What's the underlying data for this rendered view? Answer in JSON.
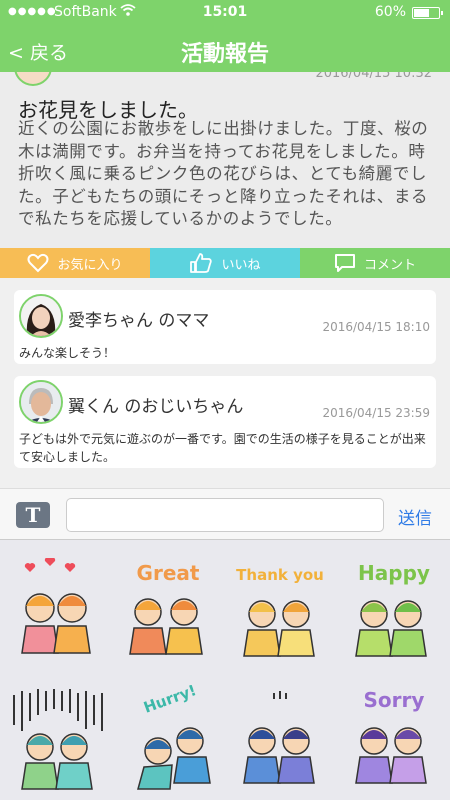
{
  "status": {
    "carrier": "SoftBank",
    "time": "15:01",
    "battery": "60%"
  },
  "nav": {
    "back_label": "< 戻る",
    "title": "活動報告"
  },
  "post": {
    "date": "2016/04/15 10:32",
    "heading": "お花見をしました。",
    "body": "近くの公園にお散歩をしに出掛けました。丁度、桜の木は満開です。お弁当を持ってお花見をしました。時折吹く風に乗るピンク色の花びらは、とても綺麗でした。子どもたちの頭にそっと降り立ったそれは、まるで私たちを応援しているかのようでした。"
  },
  "actions": {
    "favorite": "お気に入り",
    "like": "いいね",
    "comment": "コメント"
  },
  "comments": [
    {
      "name": "愛李ちゃん のママ",
      "date": "2016/04/15 18:10",
      "text": "みんな楽しそう！"
    },
    {
      "name": "翼くん のおじいちゃん",
      "date": "2016/04/15 23:59",
      "text": "子どもは外で元気に遊ぶのが一番です。園での生活の様子を見ることが出来て安心しました。"
    }
  ],
  "input": {
    "placeholder": "",
    "send_label": "送信"
  },
  "stickers": [
    {
      "name": "hearts",
      "caption": ""
    },
    {
      "name": "great",
      "caption": "Great"
    },
    {
      "name": "thank-you",
      "caption": "Thank you"
    },
    {
      "name": "happy",
      "caption": "Happy"
    },
    {
      "name": "gloomy",
      "caption": ""
    },
    {
      "name": "hurry",
      "caption": "Hurry!"
    },
    {
      "name": "crying",
      "caption": ""
    },
    {
      "name": "sorry",
      "caption": "Sorry"
    }
  ],
  "colors": {
    "accent": "#7ed36b",
    "favorite": "#f7bd55",
    "like": "#5cd3de",
    "send": "#2f7be6"
  }
}
